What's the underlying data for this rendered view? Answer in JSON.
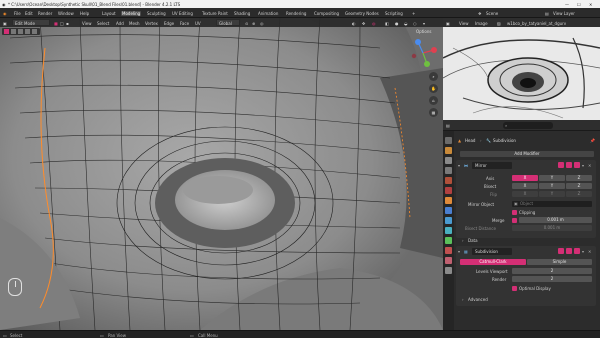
{
  "window": {
    "title_path": "* C:\\Users\\Ocean\\Desktop\\Synthetic Skull\\01_Blend Files\\01.blend] - Blender 4.2.1 LTS"
  },
  "menubar": {
    "menus": [
      "File",
      "Edit",
      "Render",
      "Window",
      "Help"
    ],
    "workspaces": [
      "Layout",
      "Modeling",
      "Sculpting",
      "UV Editing",
      "Texture Paint",
      "Shading",
      "Animation",
      "Rendering",
      "Compositing",
      "Geometry Nodes",
      "Scripting"
    ],
    "active_workspace": "Modeling",
    "scene_label": "Scene",
    "viewlayer_label": "View Layer"
  },
  "viewport_header": {
    "mode": "Edit Mode",
    "menus": [
      "View",
      "Select",
      "Add",
      "Mesh",
      "Vertex",
      "Edge",
      "Face",
      "UV"
    ],
    "orientation": "Global",
    "options_label": "Options"
  },
  "image_editor": {
    "menus": [
      "View",
      "Image"
    ],
    "image_name": "w1bco_by_tatyaniel_at_dgurv"
  },
  "properties": {
    "breadcrumb_object": "Head",
    "breadcrumb_modifier": "Subdivision",
    "add_modifier_label": "Add Modifier",
    "mirror": {
      "name": "Mirror",
      "axis_label": "Axis",
      "bisect_label": "Bisect",
      "flip_label": "Flip",
      "axes": [
        "X",
        "Y",
        "Z"
      ],
      "mirror_object_label": "Mirror Object",
      "mirror_object_placeholder": "Object",
      "clipping_label": "Clipping",
      "merge_label": "Merge",
      "merge_value": "0.001 m",
      "bisect_distance_label": "Bisect Distance",
      "bisect_distance_value": "0.001 m",
      "data_label": "Data"
    },
    "subdivision": {
      "name": "Subdivision",
      "catmull_label": "Catmull-Clark",
      "simple_label": "Simple",
      "levels_viewport_label": "Levels Viewport",
      "levels_viewport_value": "2",
      "render_label": "Render",
      "render_value": "2",
      "optimal_display_label": "Optimal Display",
      "advanced_label": "Advanced"
    }
  },
  "statusbar": {
    "select": "Select",
    "pan_view": "Pan View",
    "call_menu": "Call Menu"
  },
  "colors": {
    "accent": "#d42f75",
    "selected_edge": "#ff8c2a"
  }
}
